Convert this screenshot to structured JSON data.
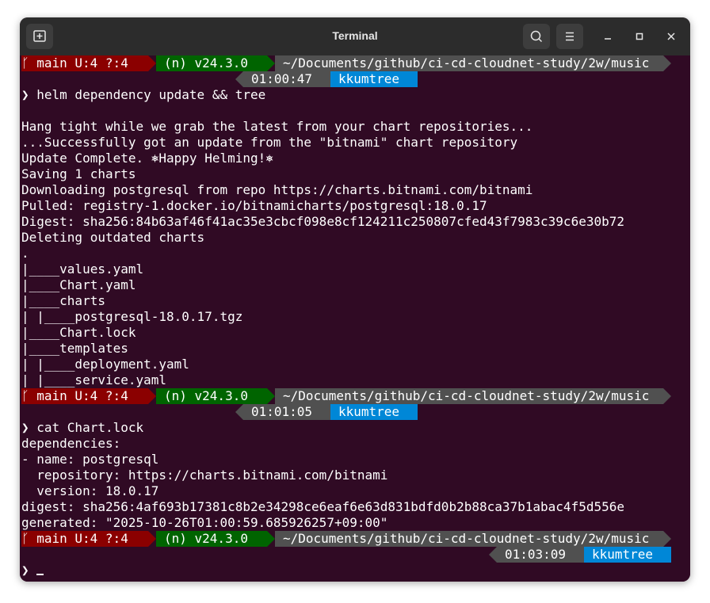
{
  "window": {
    "title": "Terminal"
  },
  "titlebar": {
    "new_tab_icon": "new-tab-icon",
    "search_icon": "search-icon",
    "menu_icon": "hamburger-menu-icon"
  },
  "colors": {
    "bg": "#300a24",
    "git_segment": "#8b0000",
    "node_segment": "#006400",
    "path_segment": "#505050",
    "time_segment": "#505050",
    "user_segment": "#0087d7"
  },
  "prompt1": {
    "git": "ᚴ main U:4 ?:4",
    "node": "(n) v24.3.0",
    "path": "~/Documents/github/ci-cd-cloudnet-study/2w/music",
    "time": "01:00:47",
    "user": "kkumtree"
  },
  "cmd1": "❯ helm dependency update && tree",
  "out1": [
    "",
    "Hang tight while we grab the latest from your chart repositories...",
    "...Successfully got an update from the \"bitnami\" chart repository",
    "Update Complete. ⎈Happy Helming!⎈",
    "Saving 1 charts",
    "Downloading postgresql from repo https://charts.bitnami.com/bitnami",
    "Pulled: registry-1.docker.io/bitnamicharts/postgresql:18.0.17",
    "Digest: sha256:84b63af46f41ac35e3cbcf098e8cf124211c250807cfed43f7983c39c6e30b72",
    "Deleting outdated charts",
    ".",
    "|____values.yaml",
    "|____Chart.yaml",
    "|____charts",
    "| |____postgresql-18.0.17.tgz",
    "|____Chart.lock",
    "|____templates",
    "| |____deployment.yaml",
    "| |____service.yaml"
  ],
  "prompt2": {
    "git": "ᚴ main U:4 ?:4",
    "node": "(n) v24.3.0",
    "path": "~/Documents/github/ci-cd-cloudnet-study/2w/music",
    "time": "01:01:05",
    "user": "kkumtree"
  },
  "cmd2": "❯ cat Chart.lock",
  "out2": [
    "dependencies:",
    "- name: postgresql",
    "  repository: https://charts.bitnami.com/bitnami",
    "  version: 18.0.17",
    "digest: sha256:4af693b17381c8b2e34298ce6eaf6e63d831bdfd0b2b88ca37b1abac4f5d556e",
    "generated: \"2025-10-26T01:00:59.685926257+09:00\""
  ],
  "prompt3": {
    "git": "ᚴ main U:4 ?:4",
    "node": "(n) v24.3.0",
    "path": "~/Documents/github/ci-cd-cloudnet-study/2w/music",
    "time": "01:03:09",
    "user": "kkumtree"
  },
  "input_prompt": "❯ "
}
